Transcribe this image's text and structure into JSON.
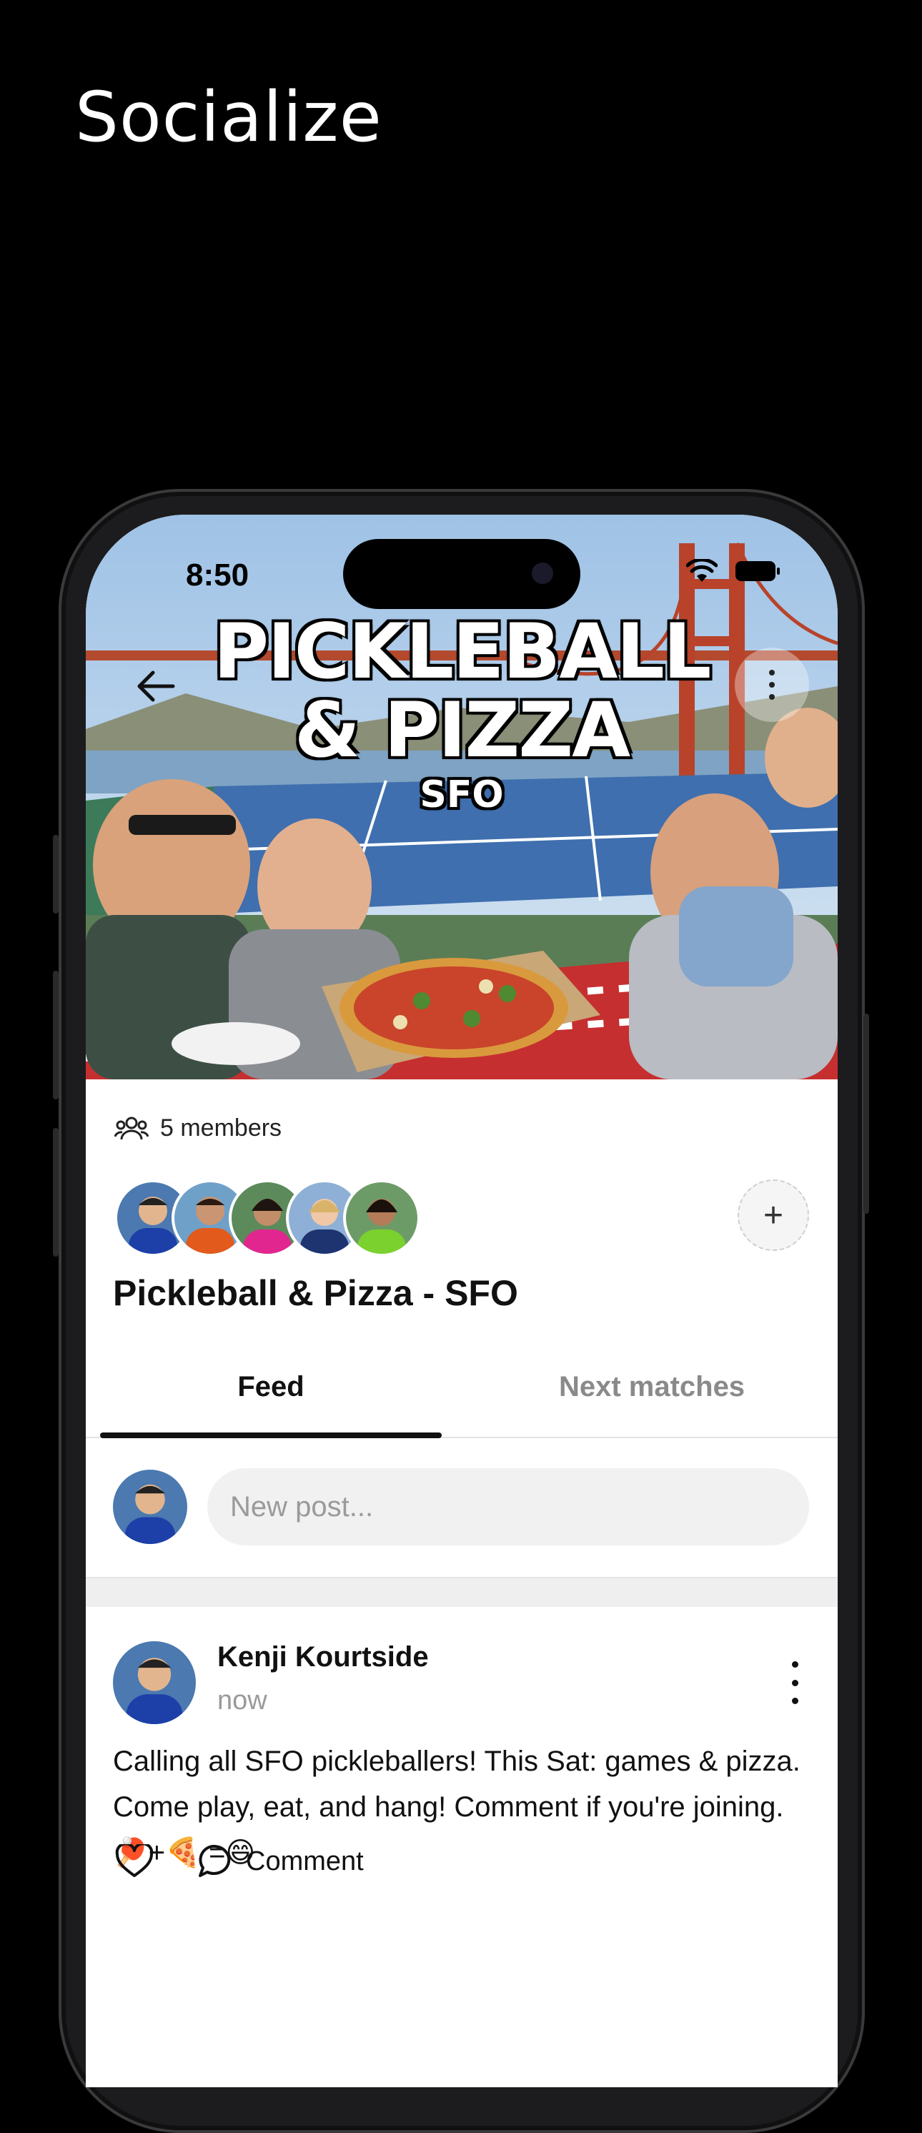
{
  "headline": "Socialize",
  "status": {
    "time": "8:50"
  },
  "hero": {
    "title_line1": "PICKLEBALL",
    "title_line2": "& PIZZA",
    "title_line3": "SFO"
  },
  "group": {
    "members_label": "5 members",
    "name": "Pickleball & Pizza - SFO",
    "add_member_symbol": "+"
  },
  "tabs": [
    {
      "label": "Feed",
      "active": true
    },
    {
      "label": "Next matches",
      "active": false
    }
  ],
  "composer": {
    "placeholder": "New post..."
  },
  "post": {
    "author": "Kenji Kourtside",
    "timestamp": "now",
    "text": "Calling all SFO pickleballers! This Sat: games & pizza. Come play, eat, and hang! Comment if you're joining. 🏓+🍕 =😄",
    "comment_label": "Comment"
  },
  "icons": {
    "back": "arrow-left-icon",
    "more": "more-vertical-icon",
    "members": "users-icon",
    "like": "heart-icon",
    "comment": "comment-icon"
  }
}
